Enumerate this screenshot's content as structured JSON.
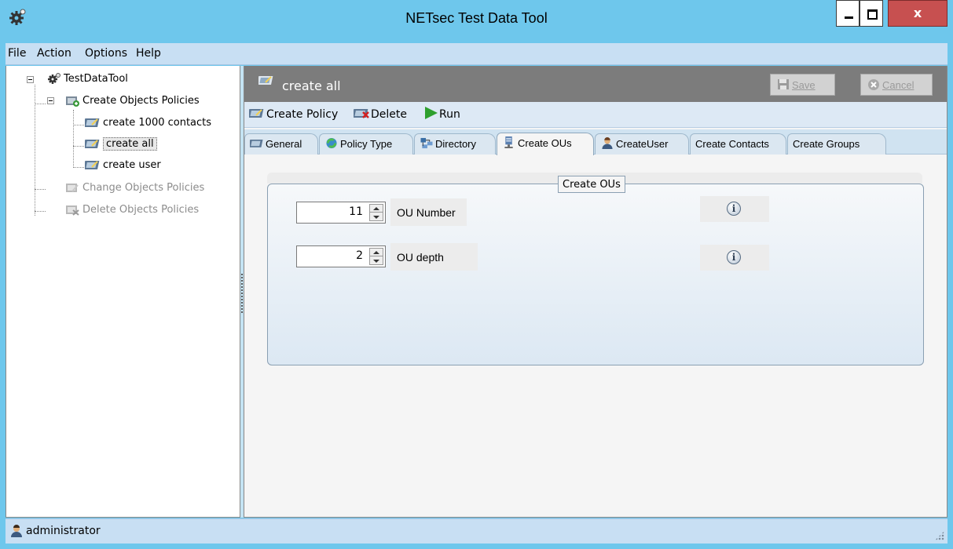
{
  "window": {
    "title": "NETsec Test Data Tool",
    "close_glyph": "x"
  },
  "menu": [
    "File",
    "Action",
    "Options",
    "Help"
  ],
  "tree": {
    "root": "TestDataTool",
    "create_policies": "Create Objects Policies",
    "items": [
      "create 1000 contacts",
      "create all",
      "create user"
    ],
    "change_policies": "Change Objects Policies",
    "delete_policies": "Delete Objects Policies"
  },
  "header": {
    "title": "create all",
    "save_label": "Save",
    "cancel_label": "Cancel"
  },
  "toolbar": {
    "create_policy": "Create Policy",
    "delete": "Delete",
    "run": "Run"
  },
  "tabs": [
    "General",
    "Policy Type",
    "Directory",
    "Create OUs",
    "CreateUser",
    "Create Contacts",
    "Create Groups"
  ],
  "active_tab": "Create OUs",
  "group": {
    "title": "Create OUs",
    "fields": [
      {
        "value": "11",
        "label": "OU Number",
        "info_glyph": "i"
      },
      {
        "value": "2",
        "label": "OU depth",
        "info_glyph": "i"
      }
    ]
  },
  "status": {
    "user": "administrator"
  },
  "colors": {
    "titlebar": "#6ec7ec",
    "header": "#7c7c7c",
    "close": "#c75050",
    "run_icon": "#2ea02e"
  }
}
